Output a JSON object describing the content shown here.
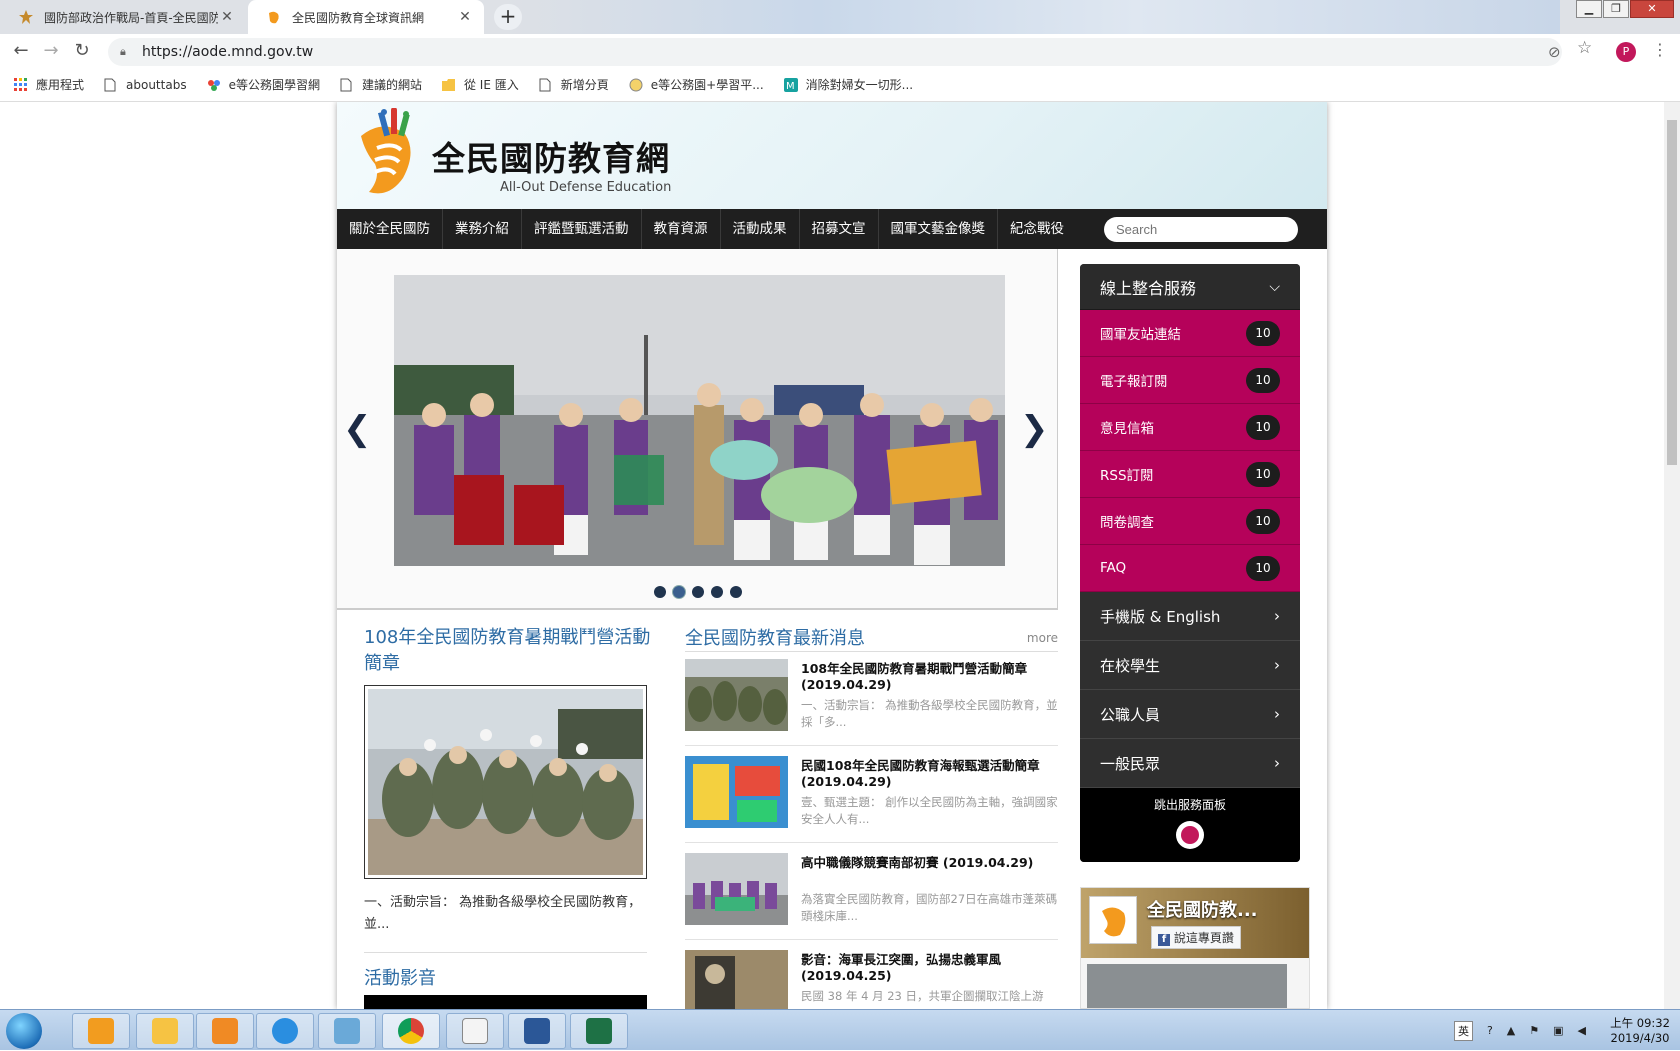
{
  "browser": {
    "tabs": [
      {
        "title": "國防部政治作戰局-首頁-全民國防",
        "active": false
      },
      {
        "title": "全民國防教育全球資訊網",
        "active": true
      }
    ],
    "url": "https://aode.mnd.gov.tw",
    "profile_initial": "P",
    "bookmarks": [
      {
        "label": "應用程式",
        "icon": "apps-grid-icon"
      },
      {
        "label": "abouttabs",
        "icon": "page-icon"
      },
      {
        "label": "e等公務園學習網",
        "icon": "flower-icon"
      },
      {
        "label": "建議的網站",
        "icon": "page-icon"
      },
      {
        "label": "從 IE 匯入",
        "icon": "folder-icon"
      },
      {
        "label": "新增分頁",
        "icon": "page-icon"
      },
      {
        "label": "e等公務園+學習平...",
        "icon": "globe-icon"
      },
      {
        "label": "消除對婦女一切形...",
        "icon": "m-logo-icon"
      }
    ]
  },
  "site": {
    "logo_title": "全民國防教育網",
    "logo_subtitle": "All-Out Defense Education",
    "nav": [
      "關於全民國防",
      "業務介紹",
      "評鑑暨甄選活動",
      "教育資源",
      "活動成果",
      "招募文宣",
      "國軍文藝金像獎",
      "紀念戰役"
    ],
    "search_placeholder": "Search",
    "slider": {
      "dots": 5,
      "active_dot": 1
    },
    "featured": {
      "title": "108年全民國防教育暑期戰鬥營活動簡章",
      "desc": "一、活動宗旨： 為推動各級學校全民國防教育，並..."
    },
    "video_section_title": "活動影音",
    "news": {
      "title": "全民國防教育最新消息",
      "more": "more",
      "items": [
        {
          "headline": "108年全民國防教育暑期戰鬥營活動簡章 (2019.04.29)",
          "summary": "一、活動宗旨： 為推動各級學校全民國防教育，並採「多..."
        },
        {
          "headline": "民國108年全民國防教育海報甄選活動簡章 (2019.04.29)",
          "summary": "壹、甄選主題： 創作以全民國防為主軸，強調國家安全人人有..."
        },
        {
          "headline": "高中職儀隊競賽南部初賽 (2019.04.29)",
          "summary": "為落實全民國防教育，國防部27日在高雄市蓬萊碼頭棧床庫..."
        },
        {
          "headline": "影音：海軍長江突圍，弘揚忠義軍風 (2019.04.25)",
          "summary": "民國 38 年 4 月 23 日，共軍企圖攔取江陰上游"
        }
      ]
    },
    "services": {
      "header": "線上整合服務",
      "links": [
        {
          "label": "國軍友站連結",
          "count": "10"
        },
        {
          "label": "電子報訂閱",
          "count": "10"
        },
        {
          "label": "意見信箱",
          "count": "10"
        },
        {
          "label": "RSS訂閱",
          "count": "10"
        },
        {
          "label": "問卷調查",
          "count": "10"
        },
        {
          "label": "FAQ",
          "count": "10"
        }
      ],
      "categories": [
        "手機版 & English",
        "在校學生",
        "公職人員",
        "一般民眾"
      ],
      "footer": "跳出服務面板"
    },
    "facebook": {
      "page_name": "全民國防教...",
      "like_label": "說這專頁讚"
    }
  },
  "taskbar": {
    "clock_time": "上午 09:32",
    "clock_date": "2019/4/30",
    "ime": "英"
  },
  "colors": {
    "accent_pink": "#b5025a",
    "link_blue": "#2e6ca4",
    "nav_dark": "#1f1f1f"
  }
}
